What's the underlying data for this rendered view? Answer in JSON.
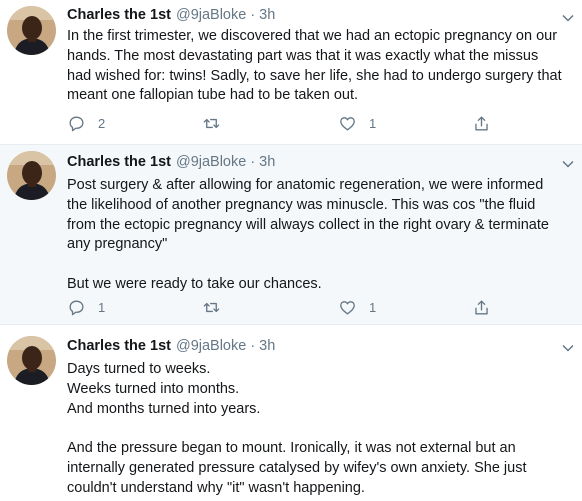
{
  "tweets": [
    {
      "display_name": "Charles the 1st",
      "handle": "@9jaBloke",
      "separator": "·",
      "time": "3h",
      "lines": [
        "In the first trimester, we discovered that we had an ectopic pregnancy on our",
        "hands. The most devastating part was that it was exactly what the missus",
        "had wished for: twins! Sadly, to save her life, she had to undergo surgery that",
        "meant one fallopian tube had to be taken out."
      ],
      "reply_count": "2",
      "like_count": "1"
    },
    {
      "display_name": "Charles the 1st",
      "handle": "@9jaBloke",
      "separator": "·",
      "time": "3h",
      "lines": [
        "Post surgery & after allowing for anatomic regeneration, we were informed",
        "the likelihood of another pregnancy was minuscle. This was cos \"the fluid",
        "from the ectopic pregnancy will always collect in the right ovary & terminate",
        "any pregnancy\"",
        "",
        "But we were ready to take our chances."
      ],
      "reply_count": "1",
      "like_count": "1"
    },
    {
      "display_name": "Charles the 1st",
      "handle": "@9jaBloke",
      "separator": "·",
      "time": "3h",
      "lines": [
        "Days turned to weeks.",
        "Weeks turned into months.",
        "And months turned into years.",
        "",
        "And the pressure began to mount. Ironically, it was not external but an",
        "internally generated pressure catalysed by wifey's own anxiety. She just",
        "couldn't understand why \"it\" wasn't happening."
      ]
    }
  ],
  "icons": {
    "reply": "reply-icon",
    "retweet": "retweet-icon",
    "like": "like-icon",
    "share": "share-icon",
    "caret": "chevron-down-icon"
  },
  "colors": {
    "text": "#14171a",
    "muted": "#657786",
    "highlight_bg": "#f5f8fa",
    "thread_line": "#ccd6dd"
  }
}
